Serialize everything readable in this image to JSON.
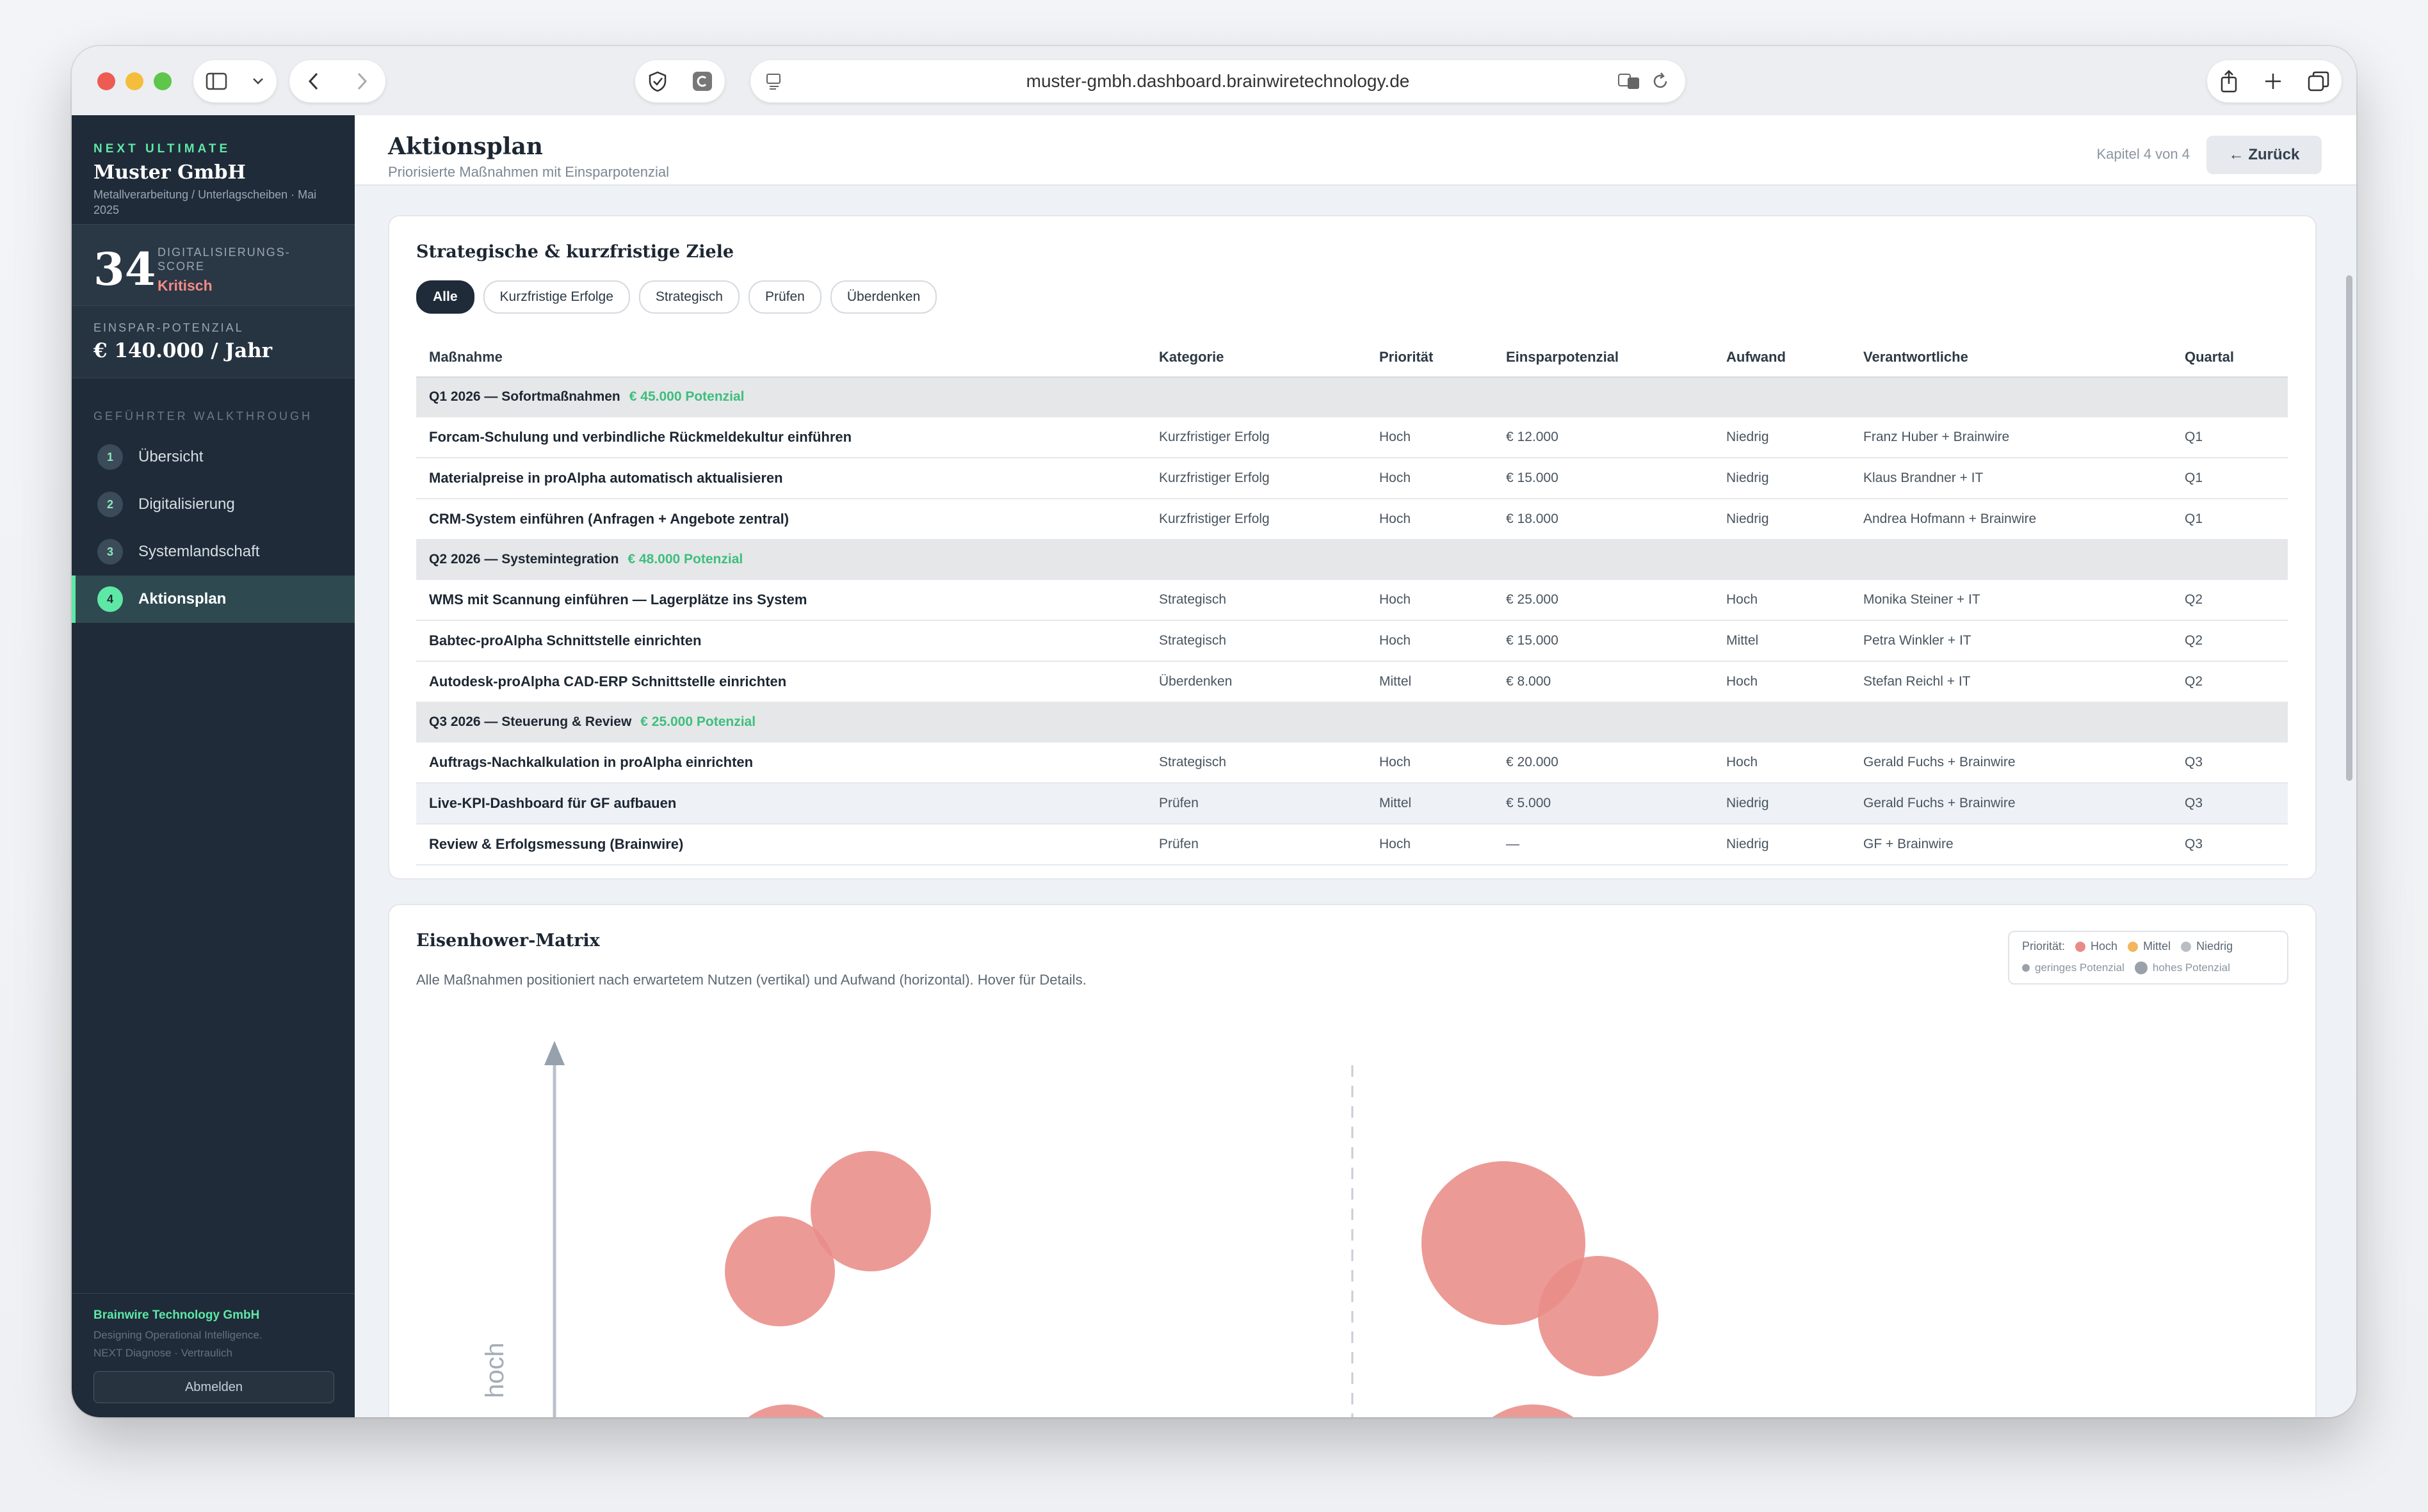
{
  "browser": {
    "url": "muster-gmbh.dashboard.brainwiretechnology.de"
  },
  "sidebar": {
    "eyebrow": "NEXT ULTIMATE",
    "company": "Muster GmbH",
    "subtitle": "Metallverarbeitung / Unterlagscheiben · Mai 2025",
    "score_value": "34",
    "score_label": "DIGITALISIERUNGS-SCORE",
    "score_status": "Kritisch",
    "savings_label": "EINSPAR-POTENZIAL",
    "savings_value": "€ 140.000 / Jahr",
    "walkthrough_label": "GEFÜHRTER WALKTHROUGH",
    "nav": [
      {
        "num": "1",
        "label": "Übersicht"
      },
      {
        "num": "2",
        "label": "Digitalisierung"
      },
      {
        "num": "3",
        "label": "Systemlandschaft"
      },
      {
        "num": "4",
        "label": "Aktionsplan"
      }
    ],
    "footer_company": "Brainwire Technology GmbH",
    "footer_tagline": "Designing Operational Intelligence.",
    "footer_note": "NEXT Diagnose · Vertraulich",
    "logout": "Abmelden"
  },
  "header": {
    "title": "Aktionsplan",
    "subtitle": "Priorisierte Maßnahmen mit Einsparpotenzial",
    "chapter": "Kapitel 4 von 4",
    "back": "← Zurück"
  },
  "plan": {
    "title": "Strategische & kurzfristige Ziele",
    "filters": [
      "Alle",
      "Kurzfristige Erfolge",
      "Strategisch",
      "Prüfen",
      "Überdenken"
    ],
    "columns": [
      "Maßnahme",
      "Kategorie",
      "Priorität",
      "Einsparpotenzial",
      "Aufwand",
      "Verantwortliche",
      "Quartal"
    ],
    "groups": [
      {
        "title": "Q1 2026 — Sofortmaßnahmen",
        "potential": "€ 45.000 Potenzial",
        "rows": [
          [
            "Forcam-Schulung und verbindliche Rückmeldekultur einführen",
            "Kurzfristiger Erfolg",
            "Hoch",
            "€ 12.000",
            "Niedrig",
            "Franz Huber + Brainwire",
            "Q1"
          ],
          [
            "Materialpreise in proAlpha automatisch aktualisieren",
            "Kurzfristiger Erfolg",
            "Hoch",
            "€ 15.000",
            "Niedrig",
            "Klaus Brandner + IT",
            "Q1"
          ],
          [
            "CRM-System einführen (Anfragen + Angebote zentral)",
            "Kurzfristiger Erfolg",
            "Hoch",
            "€ 18.000",
            "Niedrig",
            "Andrea Hofmann + Brainwire",
            "Q1"
          ]
        ]
      },
      {
        "title": "Q2 2026 — Systemintegration",
        "potential": "€ 48.000 Potenzial",
        "rows": [
          [
            "WMS mit Scannung einführen — Lagerplätze ins System",
            "Strategisch",
            "Hoch",
            "€ 25.000",
            "Hoch",
            "Monika Steiner + IT",
            "Q2"
          ],
          [
            "Babtec-proAlpha Schnittstelle einrichten",
            "Strategisch",
            "Hoch",
            "€ 15.000",
            "Mittel",
            "Petra Winkler + IT",
            "Q2"
          ],
          [
            "Autodesk-proAlpha CAD-ERP Schnittstelle einrichten",
            "Überdenken",
            "Mittel",
            "€ 8.000",
            "Hoch",
            "Stefan Reichl + IT",
            "Q2"
          ]
        ]
      },
      {
        "title": "Q3 2026 — Steuerung & Review",
        "potential": "€ 25.000 Potenzial",
        "rows": [
          [
            "Auftrags-Nachkalkulation in proAlpha einrichten",
            "Strategisch",
            "Hoch",
            "€ 20.000",
            "Hoch",
            "Gerald Fuchs + Brainwire",
            "Q3"
          ],
          [
            "Live-KPI-Dashboard für GF aufbauen",
            "Prüfen",
            "Mittel",
            "€ 5.000",
            "Niedrig",
            "Gerald Fuchs + Brainwire",
            "Q3"
          ],
          [
            "Review & Erfolgsmessung (Brainwire)",
            "Prüfen",
            "Hoch",
            "—",
            "Niedrig",
            "GF + Brainwire",
            "Q3"
          ]
        ]
      }
    ]
  },
  "matrix": {
    "title": "Eisenhower-Matrix",
    "description": "Alle Maßnahmen positioniert nach erwartetem Nutzen (vertikal) und Aufwand (horizontal). Hover für Details.",
    "legend": {
      "label": "Priorität:",
      "items": [
        {
          "label": "Hoch",
          "color": "#ea8a86"
        },
        {
          "label": "Mittel",
          "color": "#f2b65c"
        },
        {
          "label": "Niedrig",
          "color": "#b9bec4"
        }
      ],
      "size_small": "geringes Potenzial",
      "size_large": "hohes Potenzial"
    },
    "y_label": "hoch",
    "bubble_color": "#e98c87"
  },
  "colors": {
    "sidebar_bg": "#1f2b38",
    "accent": "#5ee8a6",
    "critical": "#f48a86"
  }
}
